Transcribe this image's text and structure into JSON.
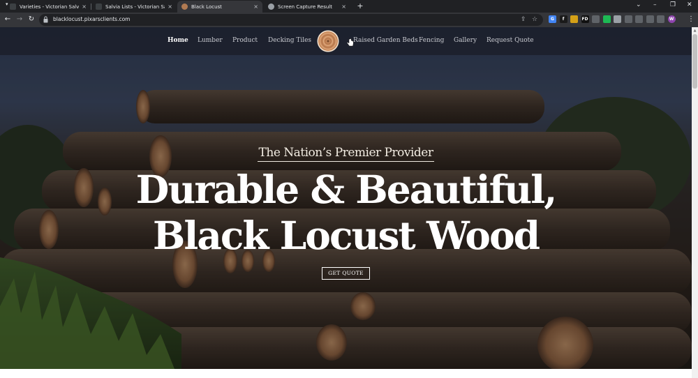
{
  "browser": {
    "tabs": [
      {
        "title": "Varieties - Victorian Salvia Study",
        "active": false,
        "favicon_color": "#3c4043"
      },
      {
        "title": "Salvia Lists - Victorian Salvia Stu",
        "active": false,
        "favicon_color": "#3c4043"
      },
      {
        "title": "Black Locust",
        "active": true,
        "favicon_color": "#b07a52"
      },
      {
        "title": "Screen Capture Result",
        "active": false,
        "favicon_color": "#9aa0a6"
      }
    ],
    "close_glyph": "×",
    "new_tab_glyph": "+",
    "url": "blacklocust.pixarsclients.com",
    "extensions": [
      {
        "label": "G",
        "color": "#4285f4"
      },
      {
        "label": "f",
        "color": "#1a1a1a"
      },
      {
        "label": "",
        "color": "#d4a017"
      },
      {
        "label": "FD",
        "color": "#111111"
      },
      {
        "label": "",
        "color": "#5f6368"
      },
      {
        "label": "",
        "color": "#1db954"
      },
      {
        "label": "",
        "color": "#9aa0a6"
      },
      {
        "label": "",
        "color": "#5f6368"
      },
      {
        "label": "",
        "color": "#5f6368"
      },
      {
        "label": "",
        "color": "#5f6368"
      },
      {
        "label": "",
        "color": "#5f6368"
      },
      {
        "label": "W",
        "color": "#8e44ad"
      }
    ]
  },
  "site": {
    "nav_left": [
      "Home",
      "Lumber",
      "Product",
      "Decking Tiles"
    ],
    "nav_right": [
      "Raised Garden Beds",
      "Fencing",
      "Gallery",
      "Request Quote"
    ],
    "eyebrow": "The Nation’s Premier Provider",
    "headline": "Durable & Beautiful, Black Locust Wood",
    "cta": "GET QUOTE"
  },
  "colors": {
    "navbar": "#1c212d",
    "logo_ring": "#c98a5c",
    "text": "#ffffff"
  }
}
